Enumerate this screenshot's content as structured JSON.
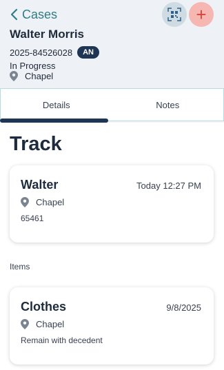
{
  "header": {
    "back_label": "Cases",
    "name": "Walter Morris",
    "case_number": "2025-84526028",
    "badge": "AN",
    "status": "In Progress",
    "location": "Chapel"
  },
  "tabs": [
    {
      "label": "Details",
      "active": true
    },
    {
      "label": "Notes",
      "active": false
    }
  ],
  "section_title": "Track",
  "track_card": {
    "title": "Walter",
    "time": "Today 12:27 PM",
    "location": "Chapel",
    "note": "65461"
  },
  "items_label": "Items",
  "item_card": {
    "title": "Clothes",
    "time": "9/8/2025",
    "location": "Chapel",
    "note": "Remain with decedent"
  },
  "colors": {
    "accent": "#2f7d86",
    "navy": "#1f3554",
    "add_red": "#d8453c"
  }
}
